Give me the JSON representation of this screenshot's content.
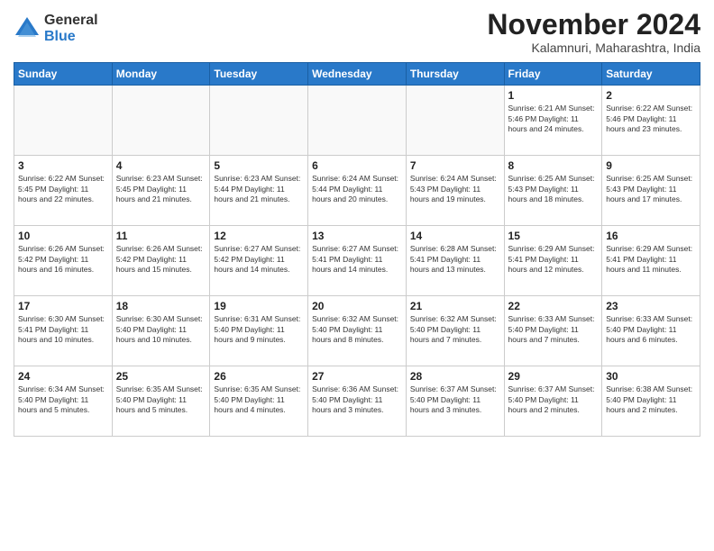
{
  "logo": {
    "general": "General",
    "blue": "Blue"
  },
  "title": "November 2024",
  "subtitle": "Kalamnuri, Maharashtra, India",
  "headers": [
    "Sunday",
    "Monday",
    "Tuesday",
    "Wednesday",
    "Thursday",
    "Friday",
    "Saturday"
  ],
  "weeks": [
    [
      {
        "day": "",
        "info": ""
      },
      {
        "day": "",
        "info": ""
      },
      {
        "day": "",
        "info": ""
      },
      {
        "day": "",
        "info": ""
      },
      {
        "day": "",
        "info": ""
      },
      {
        "day": "1",
        "info": "Sunrise: 6:21 AM\nSunset: 5:46 PM\nDaylight: 11 hours\nand 24 minutes."
      },
      {
        "day": "2",
        "info": "Sunrise: 6:22 AM\nSunset: 5:46 PM\nDaylight: 11 hours\nand 23 minutes."
      }
    ],
    [
      {
        "day": "3",
        "info": "Sunrise: 6:22 AM\nSunset: 5:45 PM\nDaylight: 11 hours\nand 22 minutes."
      },
      {
        "day": "4",
        "info": "Sunrise: 6:23 AM\nSunset: 5:45 PM\nDaylight: 11 hours\nand 21 minutes."
      },
      {
        "day": "5",
        "info": "Sunrise: 6:23 AM\nSunset: 5:44 PM\nDaylight: 11 hours\nand 21 minutes."
      },
      {
        "day": "6",
        "info": "Sunrise: 6:24 AM\nSunset: 5:44 PM\nDaylight: 11 hours\nand 20 minutes."
      },
      {
        "day": "7",
        "info": "Sunrise: 6:24 AM\nSunset: 5:43 PM\nDaylight: 11 hours\nand 19 minutes."
      },
      {
        "day": "8",
        "info": "Sunrise: 6:25 AM\nSunset: 5:43 PM\nDaylight: 11 hours\nand 18 minutes."
      },
      {
        "day": "9",
        "info": "Sunrise: 6:25 AM\nSunset: 5:43 PM\nDaylight: 11 hours\nand 17 minutes."
      }
    ],
    [
      {
        "day": "10",
        "info": "Sunrise: 6:26 AM\nSunset: 5:42 PM\nDaylight: 11 hours\nand 16 minutes."
      },
      {
        "day": "11",
        "info": "Sunrise: 6:26 AM\nSunset: 5:42 PM\nDaylight: 11 hours\nand 15 minutes."
      },
      {
        "day": "12",
        "info": "Sunrise: 6:27 AM\nSunset: 5:42 PM\nDaylight: 11 hours\nand 14 minutes."
      },
      {
        "day": "13",
        "info": "Sunrise: 6:27 AM\nSunset: 5:41 PM\nDaylight: 11 hours\nand 14 minutes."
      },
      {
        "day": "14",
        "info": "Sunrise: 6:28 AM\nSunset: 5:41 PM\nDaylight: 11 hours\nand 13 minutes."
      },
      {
        "day": "15",
        "info": "Sunrise: 6:29 AM\nSunset: 5:41 PM\nDaylight: 11 hours\nand 12 minutes."
      },
      {
        "day": "16",
        "info": "Sunrise: 6:29 AM\nSunset: 5:41 PM\nDaylight: 11 hours\nand 11 minutes."
      }
    ],
    [
      {
        "day": "17",
        "info": "Sunrise: 6:30 AM\nSunset: 5:41 PM\nDaylight: 11 hours\nand 10 minutes."
      },
      {
        "day": "18",
        "info": "Sunrise: 6:30 AM\nSunset: 5:40 PM\nDaylight: 11 hours\nand 10 minutes."
      },
      {
        "day": "19",
        "info": "Sunrise: 6:31 AM\nSunset: 5:40 PM\nDaylight: 11 hours\nand 9 minutes."
      },
      {
        "day": "20",
        "info": "Sunrise: 6:32 AM\nSunset: 5:40 PM\nDaylight: 11 hours\nand 8 minutes."
      },
      {
        "day": "21",
        "info": "Sunrise: 6:32 AM\nSunset: 5:40 PM\nDaylight: 11 hours\nand 7 minutes."
      },
      {
        "day": "22",
        "info": "Sunrise: 6:33 AM\nSunset: 5:40 PM\nDaylight: 11 hours\nand 7 minutes."
      },
      {
        "day": "23",
        "info": "Sunrise: 6:33 AM\nSunset: 5:40 PM\nDaylight: 11 hours\nand 6 minutes."
      }
    ],
    [
      {
        "day": "24",
        "info": "Sunrise: 6:34 AM\nSunset: 5:40 PM\nDaylight: 11 hours\nand 5 minutes."
      },
      {
        "day": "25",
        "info": "Sunrise: 6:35 AM\nSunset: 5:40 PM\nDaylight: 11 hours\nand 5 minutes."
      },
      {
        "day": "26",
        "info": "Sunrise: 6:35 AM\nSunset: 5:40 PM\nDaylight: 11 hours\nand 4 minutes."
      },
      {
        "day": "27",
        "info": "Sunrise: 6:36 AM\nSunset: 5:40 PM\nDaylight: 11 hours\nand 3 minutes."
      },
      {
        "day": "28",
        "info": "Sunrise: 6:37 AM\nSunset: 5:40 PM\nDaylight: 11 hours\nand 3 minutes."
      },
      {
        "day": "29",
        "info": "Sunrise: 6:37 AM\nSunset: 5:40 PM\nDaylight: 11 hours\nand 2 minutes."
      },
      {
        "day": "30",
        "info": "Sunrise: 6:38 AM\nSunset: 5:40 PM\nDaylight: 11 hours\nand 2 minutes."
      }
    ]
  ]
}
